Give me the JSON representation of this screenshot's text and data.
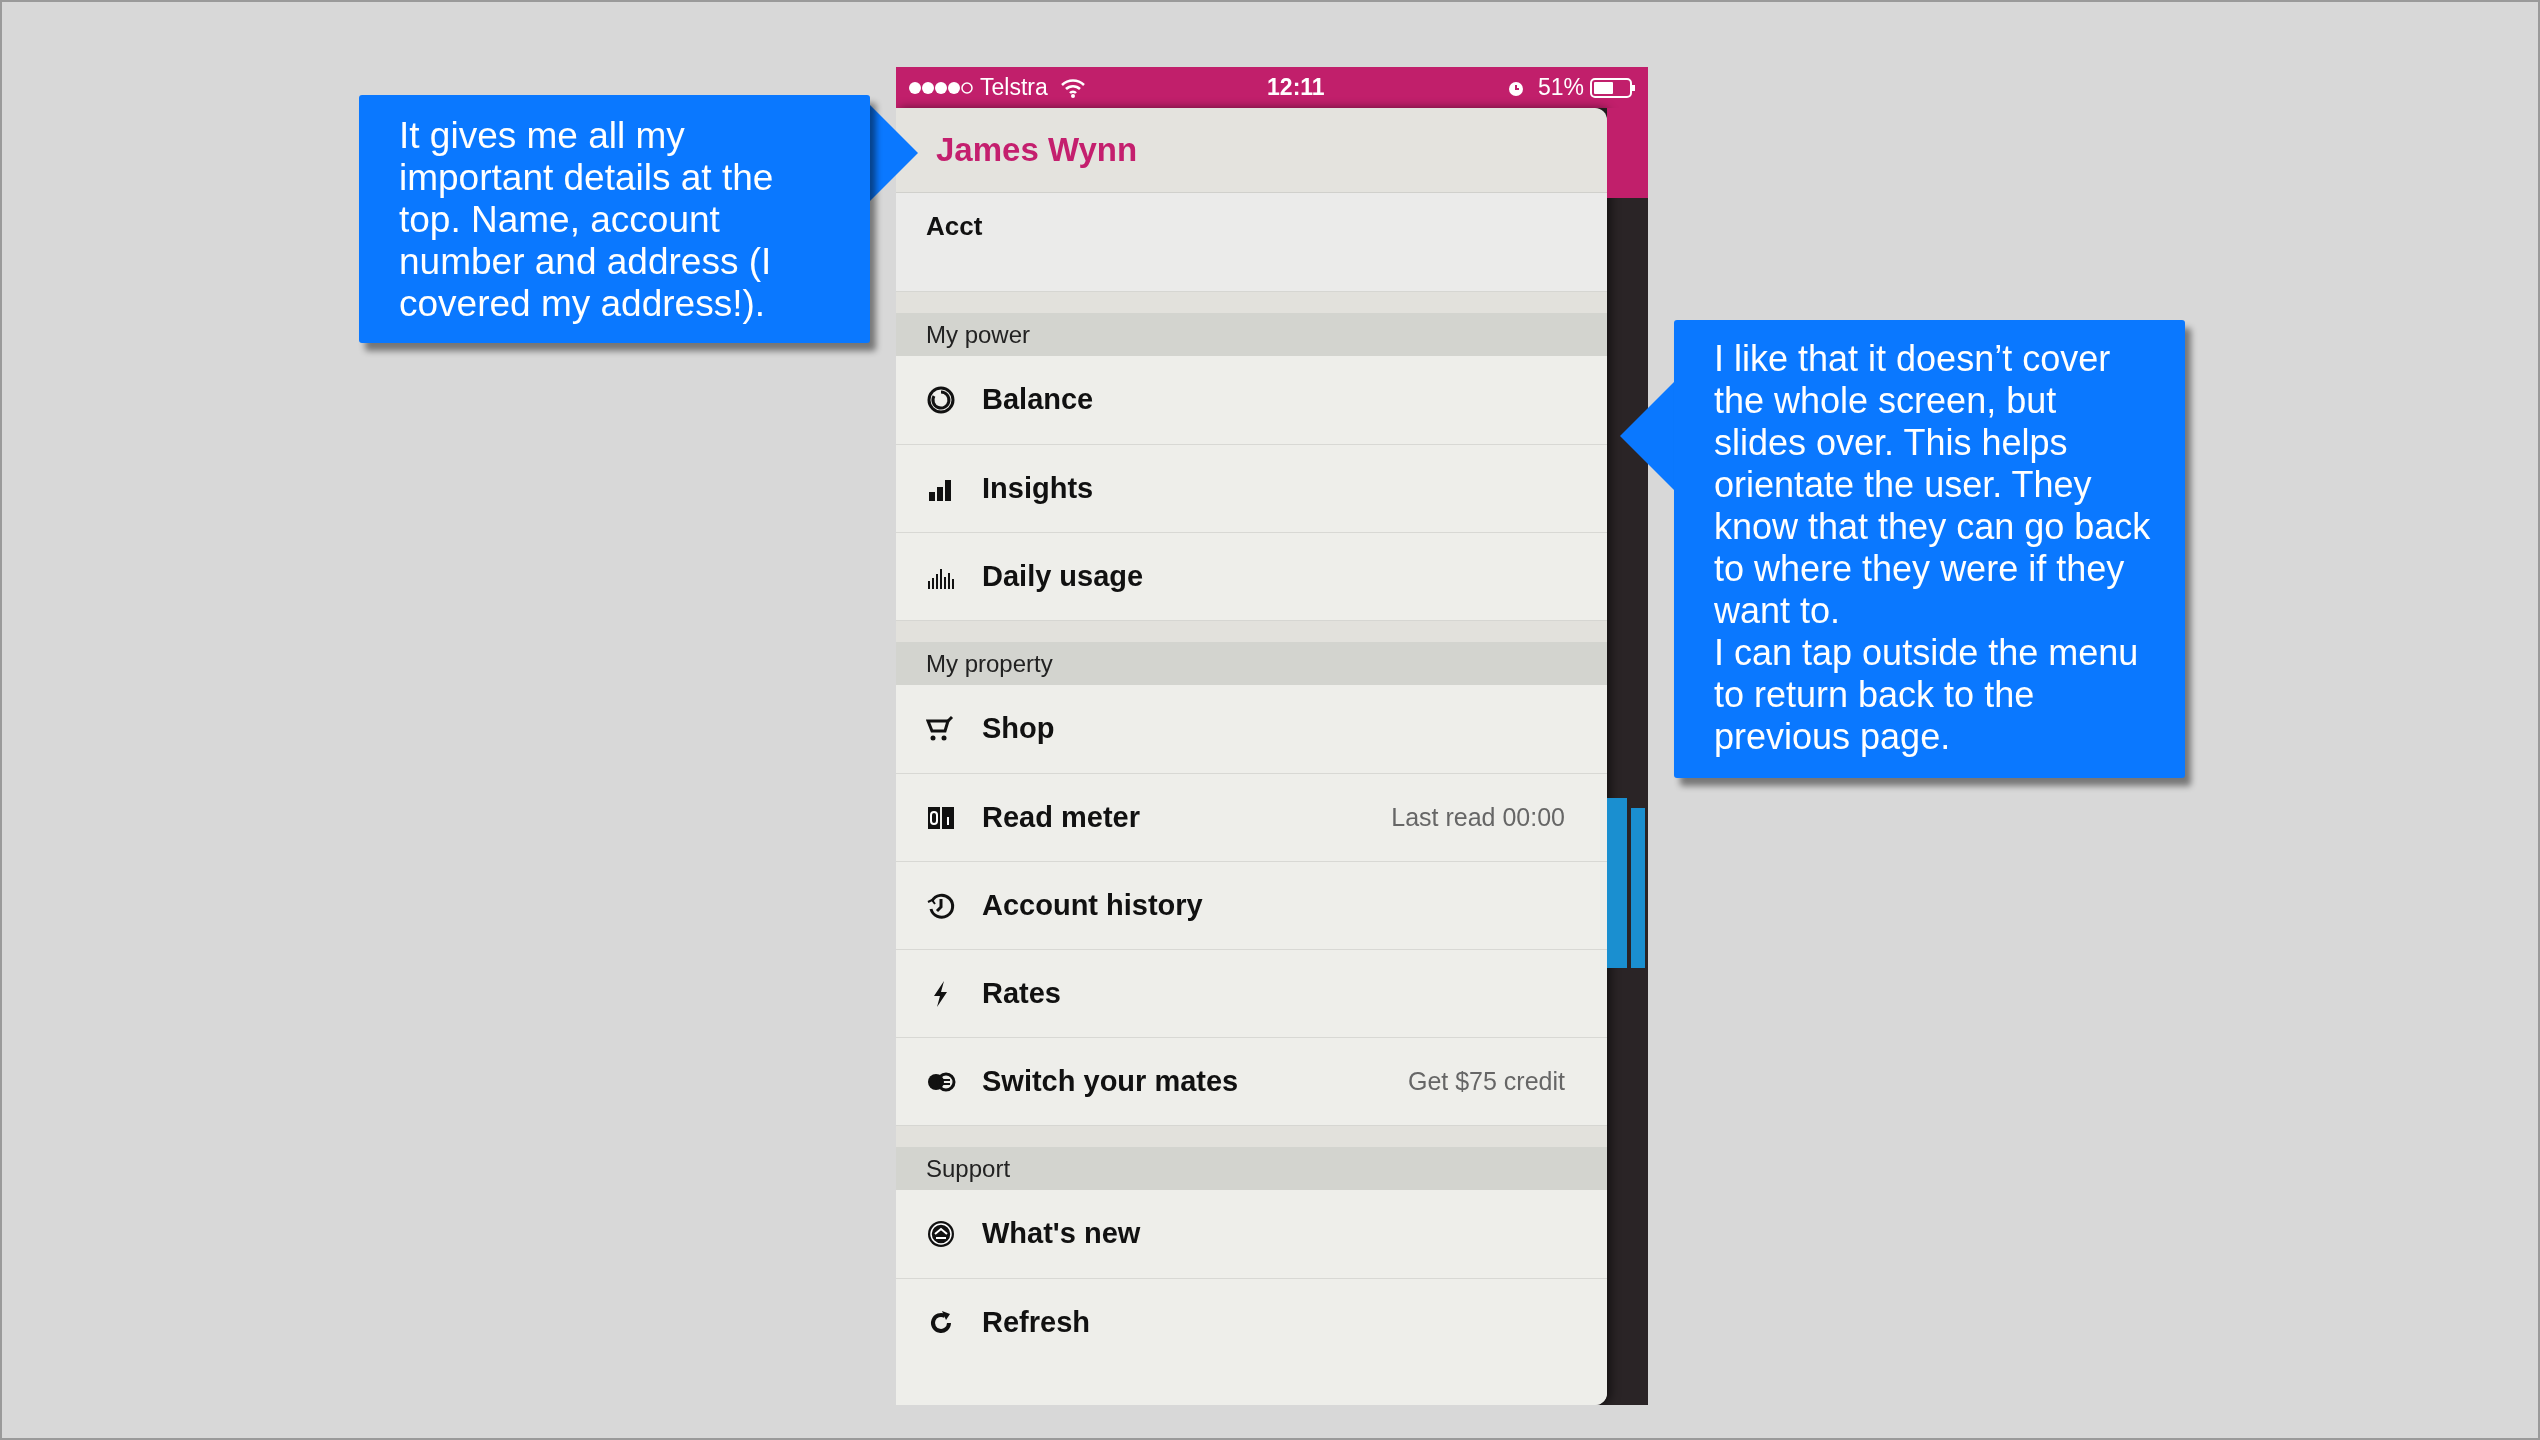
{
  "status_bar": {
    "carrier": "Telstra",
    "time": "12:11",
    "battery": "51%"
  },
  "drawer": {
    "name": "James Wynn",
    "account_label": "Acct",
    "sections": [
      {
        "title": "My power",
        "items": [
          {
            "label": "Balance"
          },
          {
            "label": "Insights"
          },
          {
            "label": "Daily usage"
          }
        ]
      },
      {
        "title": "My property",
        "items": [
          {
            "label": "Shop"
          },
          {
            "label": "Read meter",
            "detail": "Last read 00:00"
          },
          {
            "label": "Account history"
          },
          {
            "label": "Rates"
          },
          {
            "label": "Switch your mates",
            "detail": "Get $75 credit"
          }
        ]
      },
      {
        "title": "Support",
        "items": [
          {
            "label": "What's new"
          },
          {
            "label": "Refresh"
          }
        ]
      }
    ]
  },
  "callouts": [
    {
      "paragraphs": [
        "It gives me all my important details at the top. Name, account number and address (I covered my address!)."
      ]
    },
    {
      "paragraphs": [
        "I like that it doesn’t cover the whole screen, but slides over. This helps orientate the user. They know that they can go back to where they were if they want to.",
        "I can tap outside the menu to return back to the previous page."
      ]
    }
  ]
}
